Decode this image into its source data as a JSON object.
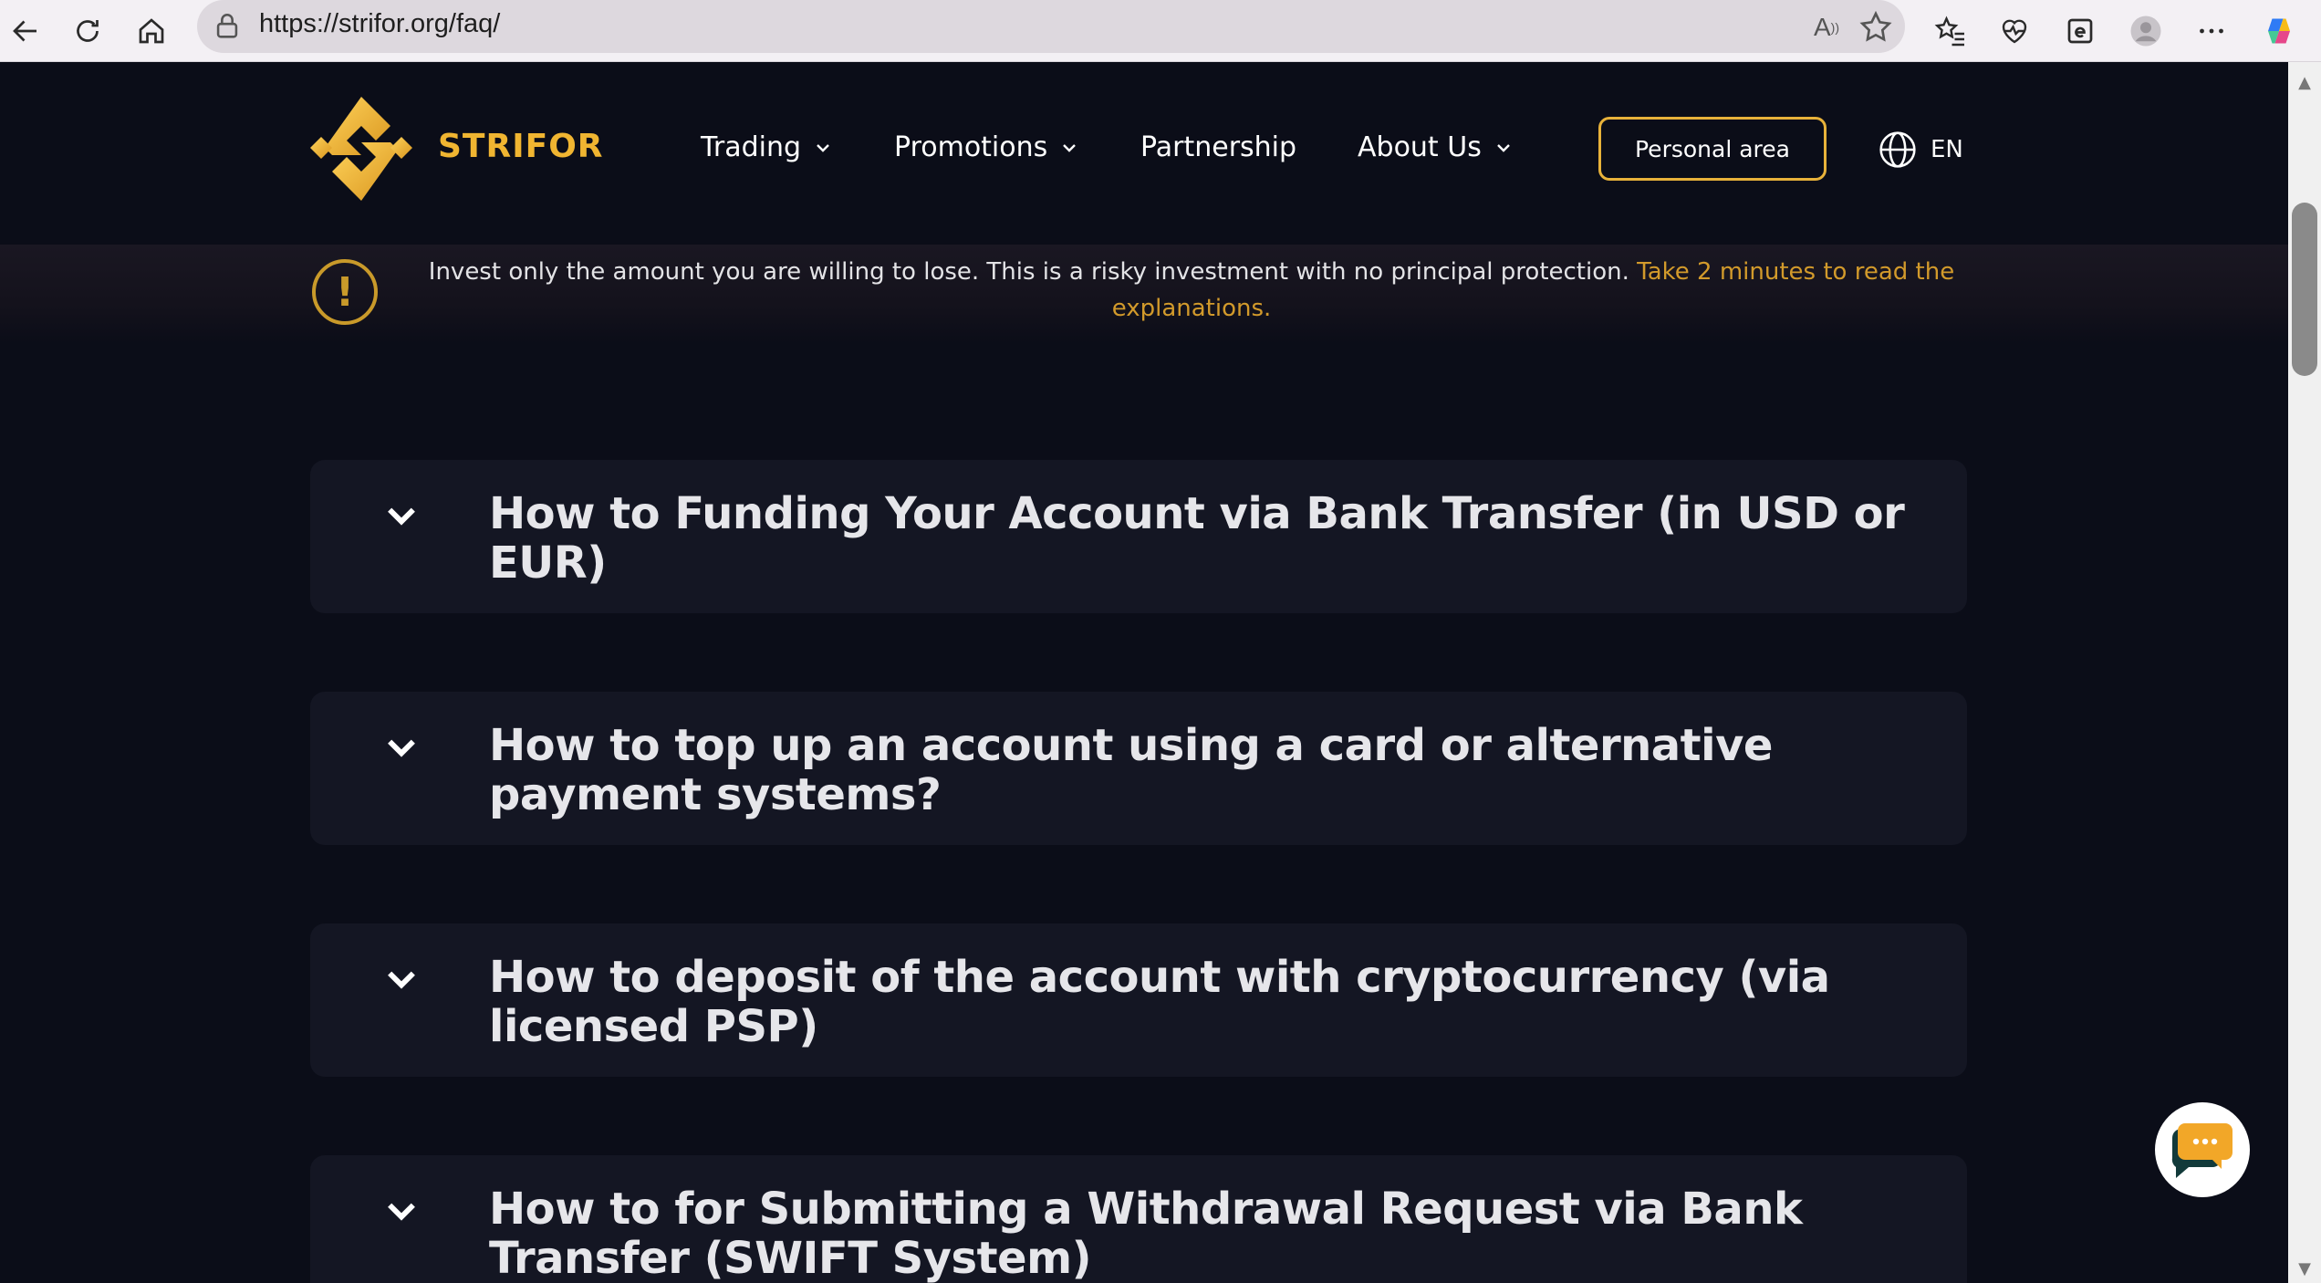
{
  "browser": {
    "url": "https://strifor.org/faq/"
  },
  "header": {
    "brand": "STRIFOR",
    "nav": [
      {
        "label": "Trading",
        "dropdown": true
      },
      {
        "label": "Promotions",
        "dropdown": true
      },
      {
        "label": "Partnership",
        "dropdown": false
      },
      {
        "label": "About Us",
        "dropdown": true
      }
    ],
    "personal_area": "Personal area",
    "language": "EN"
  },
  "warning": {
    "text": "Invest only the amount you are willing to lose. This is a risky investment with no principal protection. ",
    "link": "Take 2 minutes to read the explanations."
  },
  "faq": [
    {
      "question": "How to Funding Your Account via Bank Transfer (in USD or EUR)"
    },
    {
      "question": "How to top up an account using a card or alternative payment systems?"
    },
    {
      "question": "How to deposit of the account with cryptocurrency (via licensed PSP)"
    },
    {
      "question": "How to for Submitting a Withdrawal Request via Bank Transfer (SWIFT System)"
    }
  ],
  "colors": {
    "accent": "#f0b531",
    "background": "#0b0d18",
    "card": "#141623"
  },
  "icons": [
    "back-icon",
    "refresh-icon",
    "home-icon",
    "lock-icon",
    "read-aloud-icon",
    "favorite-star-icon",
    "favorites-icon",
    "health-icon",
    "ie-mode-icon",
    "profile-icon",
    "more-icon",
    "copilot-icon",
    "globe-icon",
    "warning-icon",
    "chevron-down-icon",
    "chat-icon"
  ]
}
